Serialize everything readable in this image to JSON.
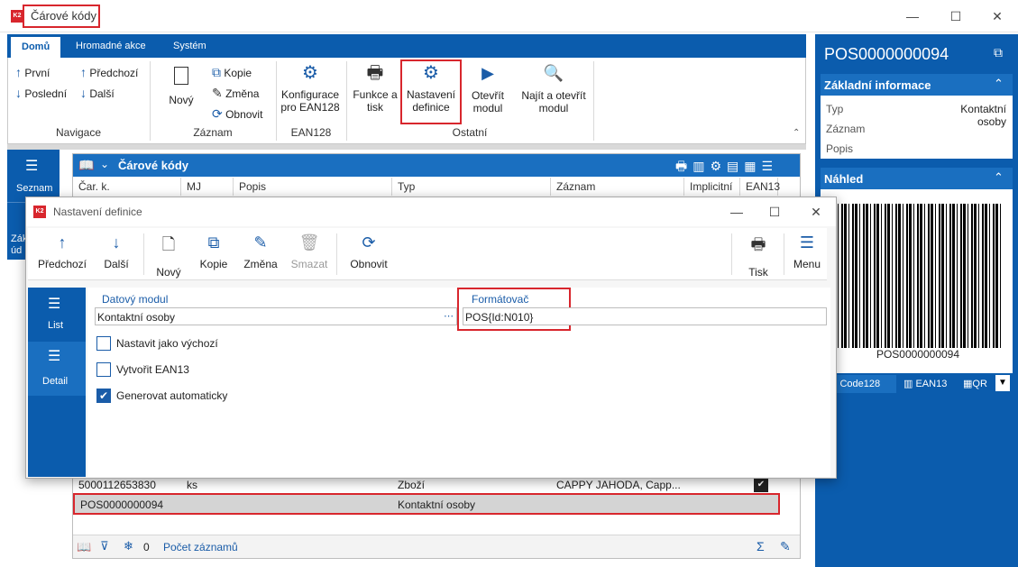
{
  "window": {
    "logo": "K2",
    "title": "Čárové kódy"
  },
  "tabs": [
    "Domů",
    "Hromadné akce",
    "Systém"
  ],
  "ribbon": {
    "nav": {
      "first": "První",
      "prev": "Předchozí",
      "last": "Poslední",
      "next": "Další",
      "group": "Navigace"
    },
    "record": {
      "new": "Nový",
      "copy": "Kopie",
      "change": "Změna",
      "refresh": "Obnovit",
      "group": "Záznam"
    },
    "ean": {
      "config_l1": "Konfigurace",
      "config_l2": "pro EAN128",
      "group": "EAN128"
    },
    "other": {
      "func_l1": "Funkce a",
      "func_l2": "tisk",
      "settings_l1": "Nastavení",
      "settings_l2": "definice",
      "open_l1": "Otevřít",
      "open_l2": "modul",
      "find_l1": "Najít a otevřít",
      "find_l2": "modul",
      "group": "Ostatní"
    }
  },
  "leftnav": {
    "list": "Seznam",
    "basic_l1": "Zákl",
    "basic_l2": "úd"
  },
  "grid": {
    "title": "Čárové kódy",
    "columns": [
      "Čar. k.",
      "MJ",
      "Popis",
      "Typ",
      "Záznam",
      "Implicitní",
      "EAN13"
    ],
    "rows": [
      {
        "code": "5000112653830",
        "mj": "ks",
        "popis": "",
        "typ": "Zboží",
        "zaznam": "CAPPY JAHODA, Capp...",
        "checked": "✔"
      },
      {
        "code": "POS0000000094",
        "mj": "",
        "popis": "",
        "typ": "Kontaktní osoby",
        "zaznam": "",
        "checked": ""
      }
    ],
    "footer_count": "0",
    "footer_label": "Počet záznamů"
  },
  "right": {
    "title": "POS0000000094",
    "section1": "Základní informace",
    "type_label": "Typ",
    "type_value": "Kontaktní osoby",
    "record_label": "Záznam",
    "desc_label": "Popis",
    "section2": "Náhled",
    "barcode_text": "POS0000000094",
    "tab_code128": "Code128",
    "tab_ean13": "EAN13",
    "tab_qr": "QR"
  },
  "dialog": {
    "title": "Nastavení definice",
    "toolbar": {
      "prev": "Předchozí",
      "next": "Další",
      "new": "Nový",
      "copy": "Kopie",
      "change": "Změna",
      "delete": "Smazat",
      "refresh": "Obnovit",
      "print": "Tisk",
      "menu": "Menu"
    },
    "side": {
      "list": "List",
      "detail": "Detail"
    },
    "module_label": "Datový modul",
    "module_value": "Kontaktní osoby",
    "formatter_label": "Formátovač",
    "formatter_value": "POS{Id:N010}",
    "cb1": "Nastavit jako výchozí",
    "cb2": "Vytvořit EAN13",
    "cb3": "Generovat automaticky"
  }
}
